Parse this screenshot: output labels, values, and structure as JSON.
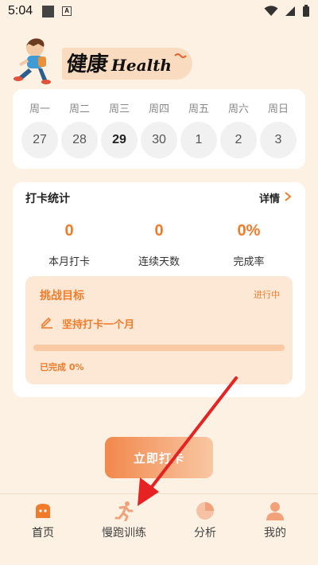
{
  "status_bar": {
    "time": "5:04"
  },
  "brand": {
    "title_cn": "健康",
    "title_en": "Health"
  },
  "week": {
    "weekdays": [
      "周一",
      "周二",
      "周三",
      "周四",
      "周五",
      "周六",
      "周日"
    ],
    "days": [
      "27",
      "28",
      "29",
      "30",
      "1",
      "2",
      "3"
    ],
    "today_index": 2
  },
  "stats": {
    "title": "打卡统计",
    "detail_label": "详情",
    "metrics": [
      {
        "value": "0",
        "label": "本月打卡"
      },
      {
        "value": "0",
        "label": "连续天数"
      },
      {
        "value": "0%",
        "label": "完成率"
      }
    ]
  },
  "challenge": {
    "title": "挑战目标",
    "status": "进行中",
    "goal": "坚持打卡一个月",
    "progress_fraction": 0,
    "done_text": "已完成 0%"
  },
  "checkin_button": {
    "label": "立即打卡"
  },
  "tabs": [
    {
      "label": "首页",
      "icon": "home-icon"
    },
    {
      "label": "慢跑训练",
      "icon": "running-icon"
    },
    {
      "label": "分析",
      "icon": "pie-chart-icon"
    },
    {
      "label": "我的",
      "icon": "profile-icon"
    }
  ],
  "colors": {
    "accent": "#f07c2b",
    "background": "#fdf1e4",
    "tab_icon": "#f2a27a"
  }
}
